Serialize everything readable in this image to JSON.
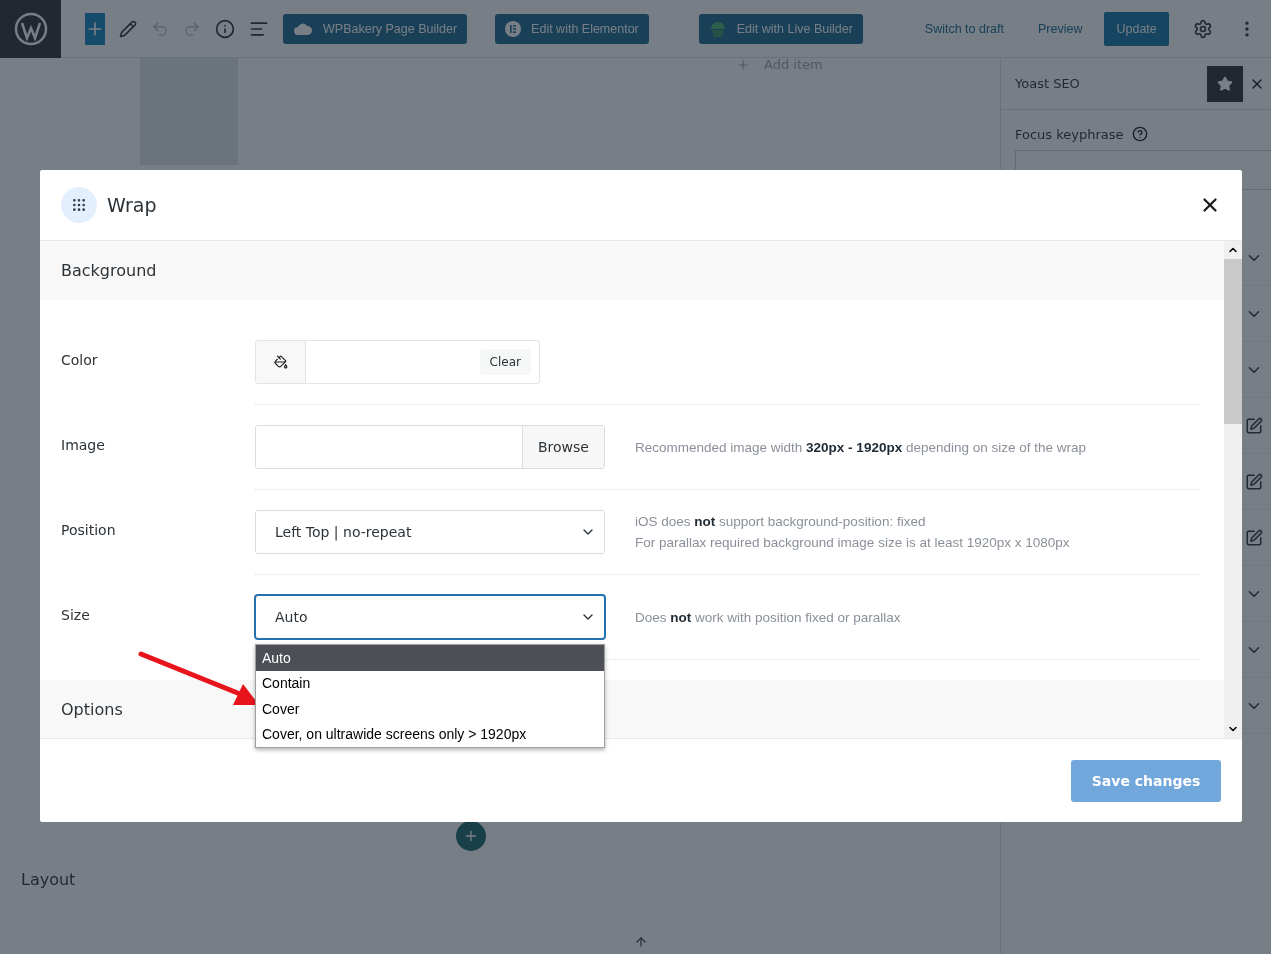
{
  "toolbar": {
    "builders": [
      {
        "kind": "wpbakery",
        "label": "WPBakery Page Builder"
      },
      {
        "kind": "elementor",
        "label": "Edit with Elementor"
      },
      {
        "kind": "live",
        "label": "Edit with Live Builder"
      }
    ],
    "actions": [
      {
        "kind": "link",
        "label": "Switch to draft"
      },
      {
        "kind": "link",
        "label": "Preview"
      },
      {
        "kind": "primary",
        "label": "Update"
      }
    ]
  },
  "canvas": {
    "add_item": "Add item",
    "section_title": "Layout"
  },
  "sidebar": {
    "title": "Yoast SEO",
    "field_label": "Focus keyphrase"
  },
  "modal": {
    "title": "Wrap",
    "sections": [
      {
        "title": "Background",
        "fields": [
          {
            "kind": "color",
            "label": "Color",
            "button": "Clear"
          },
          {
            "kind": "image",
            "label": "Image",
            "button": "Browse",
            "help": [
              "Recommended image width **320px - 1920px** depending on size of the wrap"
            ]
          },
          {
            "kind": "select",
            "label": "Position",
            "value": "Left Top | no-repeat",
            "focused": false,
            "help": [
              "iOS does **not** support background-position: fixed",
              "For parallax required background image size is at least 1920px x 1080px"
            ]
          },
          {
            "kind": "select",
            "label": "Size",
            "value": "Auto",
            "focused": true,
            "help": [
              "Does **not** work with position fixed or parallax"
            ],
            "options": [
              {
                "label": "Auto",
                "selected": true
              },
              {
                "label": "Contain",
                "selected": false
              },
              {
                "label": "Cover",
                "selected": false
              },
              {
                "label": "Cover, on ultrawide screens only > 1920px",
                "selected": false
              }
            ]
          }
        ]
      },
      {
        "title": "Options"
      }
    ],
    "save_button": "Save changes"
  }
}
